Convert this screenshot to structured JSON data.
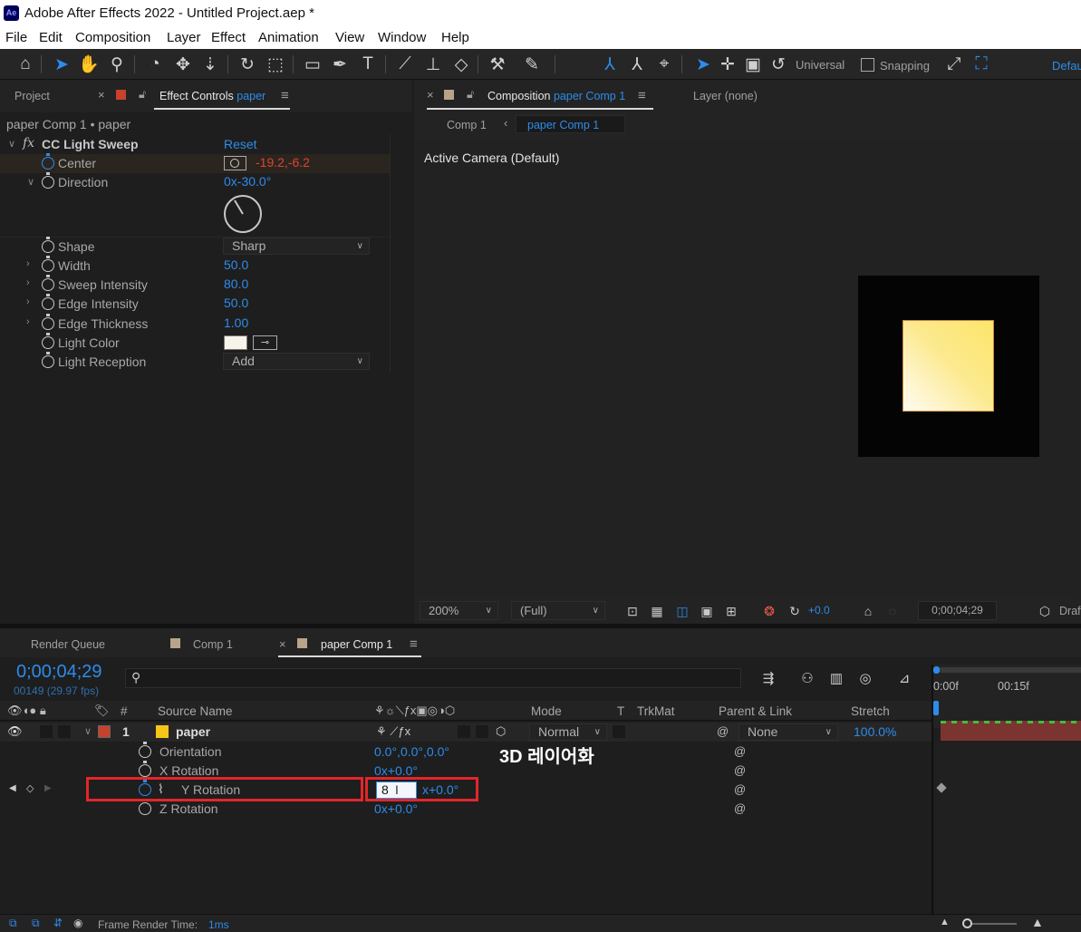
{
  "window": {
    "title": "Adobe After Effects 2022 - Untitled Project.aep *",
    "app_icon": "Ae"
  },
  "menu": [
    "File",
    "Edit",
    "Composition",
    "Layer",
    "Effect",
    "Animation",
    "View",
    "Window",
    "Help"
  ],
  "toolbar": {
    "universal_label": "Universal",
    "snapping_label": "Snapping",
    "workspace_label": "Default"
  },
  "left_panel": {
    "tabs": {
      "project": "Project",
      "effect_controls": "Effect Controls",
      "effect_controls_layer": "paper"
    },
    "breadcrumb": "paper Comp 1 • paper",
    "effect": {
      "fx_icon": "fx",
      "name": "CC Light Sweep",
      "reset": "Reset"
    },
    "properties": {
      "center": {
        "label": "Center",
        "value": "-19.2,-6.2"
      },
      "direction": {
        "label": "Direction",
        "value": "0x-30.0°"
      },
      "shape": {
        "label": "Shape",
        "value": "Sharp"
      },
      "width": {
        "label": "Width",
        "value": "50.0"
      },
      "sweep_intensity": {
        "label": "Sweep Intensity",
        "value": "80.0"
      },
      "edge_intensity": {
        "label": "Edge Intensity",
        "value": "50.0"
      },
      "edge_thickness": {
        "label": "Edge Thickness",
        "value": "1.00"
      },
      "light_color": {
        "label": "Light Color",
        "color": "#f6f3ea"
      },
      "light_reception": {
        "label": "Light Reception",
        "value": "Add"
      }
    }
  },
  "comp_panel": {
    "tabs": {
      "composition": "Composition",
      "composition_name": "paper Comp 1",
      "layer": "Layer (none)"
    },
    "flow": {
      "comp1": "Comp 1",
      "current": "paper Comp 1"
    },
    "camera_label": "Active Camera (Default)",
    "footer": {
      "zoom": "200%",
      "resolution": "(Full)",
      "exposure": "+0.0",
      "timecode": "0;00;04;29",
      "renderer": "Draft"
    }
  },
  "timeline": {
    "tabs": {
      "render_queue": "Render Queue",
      "comp1": "Comp 1",
      "paper_comp1": "paper Comp 1"
    },
    "current_time": "0;00;04;29",
    "frame_info": "00149 (29.97 fps)",
    "headers": {
      "hash": "#",
      "source_name": "Source Name",
      "mode": "Mode",
      "t": "T",
      "trkmat": "TrkMat",
      "parent": "Parent & Link",
      "stretch": "Stretch"
    },
    "layer": {
      "index": "1",
      "name": "paper",
      "label_color": "#c8412c",
      "mode": "Normal",
      "parent": "None",
      "stretch": "100.0%"
    },
    "props": {
      "orientation": {
        "label": "Orientation",
        "value": "0.0°,0.0°,0.0°"
      },
      "x_rotation": {
        "label": "X Rotation",
        "value": "0x+0.0°"
      },
      "y_rotation": {
        "label": "Y Rotation",
        "input": "8",
        "value": "x+0.0°"
      },
      "z_rotation": {
        "label": "Z Rotation",
        "value": "0x+0.0°"
      }
    },
    "annotation": "3D 레이어화",
    "ruler": {
      "t0": "0:00f",
      "t1": "00:15f"
    },
    "status": {
      "label": "Frame Render Time:",
      "value": "1ms"
    }
  },
  "colors": {
    "accent_blue": "#2d8ceb",
    "highlight_red": "#e3262a",
    "center_value": "#e0442c",
    "layer_bar": "#7c3430"
  }
}
